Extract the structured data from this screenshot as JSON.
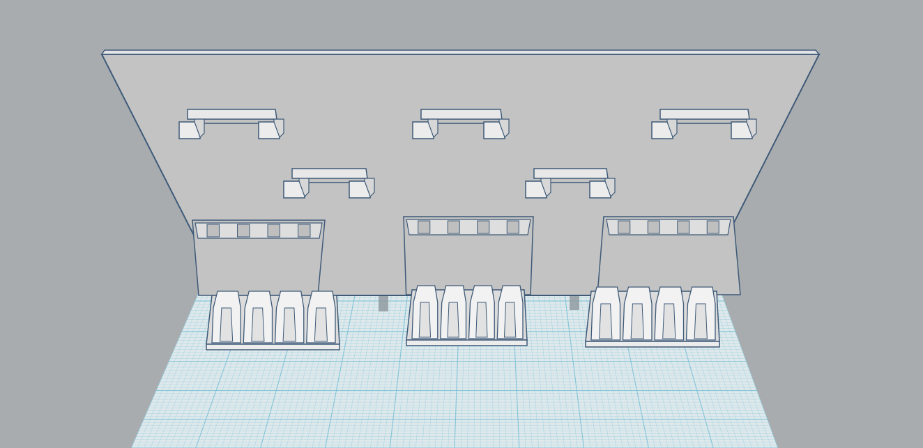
{
  "viewport": {
    "background_color": "#a8acaf",
    "grid_color": "#7fc3d8",
    "grid_bg_color": "#dfe9ec",
    "wall_color": "#c3c3c3",
    "edge_color": "#3e5a78",
    "part_color": "#ececec"
  },
  "scene": {
    "hooks_top_row": 3,
    "hooks_middle_row": 2,
    "holders": 3,
    "slots_per_holder": 4
  }
}
